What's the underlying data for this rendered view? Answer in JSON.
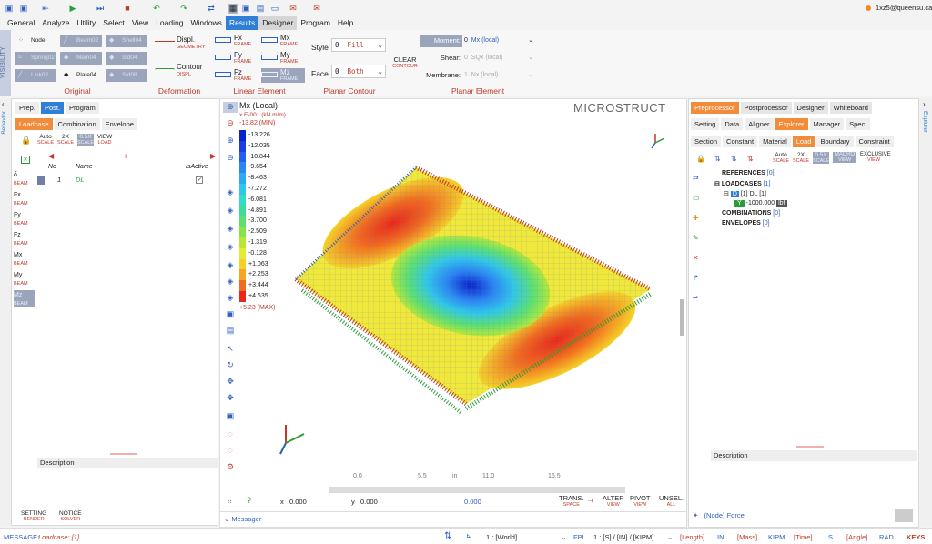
{
  "user": "1xz5@queensu.ca",
  "menu": [
    "General",
    "Analyze",
    "Utility",
    "Select",
    "View",
    "Loading",
    "Windows",
    "Results",
    "Designer",
    "Program",
    "Help"
  ],
  "ribbon": {
    "visibility": "VISIBILITY",
    "original": {
      "title": "Original",
      "items": [
        "Node",
        "Beam02",
        "Shell04",
        "Spring02",
        "Mem04",
        "Sld04",
        "Link02",
        "Plate04",
        "Sld08"
      ]
    },
    "deformation": {
      "title": "Deformation",
      "displ": "Displ.",
      "displ_sub": "GEOMETRY",
      "contour": "Contour",
      "contour_sub": "DISPL"
    },
    "linear": {
      "title": "Linear Element",
      "items": [
        {
          "l": "Fx",
          "s": "FRAME"
        },
        {
          "l": "Mx",
          "s": "FRAME"
        },
        {
          "l": "Fy",
          "s": "FRAME"
        },
        {
          "l": "My",
          "s": "FRAME"
        },
        {
          "l": "Fz",
          "s": "FRAME"
        },
        {
          "l": "Mz",
          "s": "FRAME"
        }
      ]
    },
    "planar": {
      "title": "Planar Contour",
      "style_label": "Style",
      "style_num": "0",
      "style_val": "Fill",
      "face_label": "Face",
      "face_num": "0",
      "face_val": "Both"
    },
    "clear": "CLEAR",
    "clear_sub": "CONTOUR",
    "planar_el": {
      "title": "Planar Element",
      "moment": "Moment:",
      "moment_num": "0",
      "moment_val": "Mx (local)",
      "shear": "Shear:",
      "shear_num": "0",
      "shear_val": "SQx (local)",
      "membrane": "Membrane:",
      "membrane_num": "1",
      "membrane_val": "Nx (local)"
    }
  },
  "left": {
    "behavior": "Behavior",
    "tabs": [
      "Prep.",
      "Post.",
      "Program"
    ],
    "subtabs": [
      "Loadcase",
      "Combination",
      "Envelope"
    ],
    "tools": [
      {
        "l": "Auto",
        "s": "SCALE"
      },
      {
        "l": "2X",
        "s": "SCALE"
      },
      {
        "l": "0.5X",
        "s": "SCALE"
      },
      {
        "l": "VIEW",
        "s": "LOAD"
      }
    ],
    "headers": [
      "No",
      "Name",
      "IsActive"
    ],
    "rows": [
      {
        "no": "1",
        "name": "DL"
      }
    ],
    "side": [
      {
        "l": "δ",
        "s": "BEAM"
      },
      {
        "l": "Fx",
        "s": "BEAM"
      },
      {
        "l": "Fy",
        "s": "BEAM"
      },
      {
        "l": "Fz",
        "s": "BEAM"
      },
      {
        "l": "Mx",
        "s": "BEAM"
      },
      {
        "l": "My",
        "s": "BEAM"
      },
      {
        "l": "Mz",
        "s": "BEAM"
      }
    ],
    "description": "Description",
    "setting": "SETTING",
    "setting_sub": "RENDER",
    "notice": "NOTICE",
    "notice_sub": "SOLVER"
  },
  "view": {
    "title": "Mx (Local)",
    "unit": "x E-001 (kN m/m)",
    "min": "-13.82 (MIN)",
    "max": "+5.23 (MAX)",
    "brand": "MICROSTRUCT",
    "legend": [
      "-13.226",
      "-12.035",
      "-10.844",
      "-9.654",
      "-8.463",
      "-7.272",
      "-6.081",
      "-4.891",
      "-3.700",
      "-2.509",
      "-1.319",
      "-0.128",
      "+1.063",
      "+2.253",
      "+3.444",
      "+4.635"
    ],
    "legend_colors": [
      "#0a22c8",
      "#1a3ee0",
      "#2460f0",
      "#2a86f4",
      "#2eaaf2",
      "#30c8e8",
      "#32dcc8",
      "#3edc98",
      "#5ee070",
      "#86e44a",
      "#b6e83a",
      "#e2ec32",
      "#f4d22a",
      "#f6a424",
      "#f26a1e",
      "#e8281a"
    ],
    "ruler": [
      "0.0",
      "5.5",
      "in",
      "11.0",
      "16.5"
    ],
    "x_label": "x",
    "x_val": "0.000",
    "y_label": "y",
    "y_val": "0.000",
    "z_val": "0.000",
    "tools": [
      {
        "l": "TRANS.",
        "s": "SPACE"
      },
      {
        "l": "ALTER",
        "s": "VIEW"
      },
      {
        "l": "PIVOT",
        "s": "VIEW"
      },
      {
        "l": "UNSEL.",
        "s": "ALL"
      }
    ],
    "messager": "Messager"
  },
  "right": {
    "explorer": "Explorer",
    "tabs": [
      "Preprocessor",
      "Postprocessor",
      "Designer",
      "Whiteboard"
    ],
    "tabs2": [
      "Setting",
      "Data",
      "Aligner",
      "Explorer",
      "Manager",
      "Spec."
    ],
    "tabs3": [
      "Section",
      "Constant",
      "Material",
      "Load",
      "Boundary",
      "Constraint"
    ],
    "tools": [
      {
        "l": "Auto",
        "s": "SCALE"
      },
      {
        "l": "2X",
        "s": "SCALE"
      },
      {
        "l": "0.5X",
        "s": "SCALE"
      },
      {
        "l": "MACRO",
        "s": "VIEW"
      },
      {
        "l": "EXCLUSIVE",
        "s": "VIEW"
      }
    ],
    "tree": {
      "references": "REFERENCES",
      "ref_count": "[0]",
      "loadcases": "LOADCASES",
      "lc_count": "[1]",
      "lc_item": "[1] DL [1]",
      "load_val": "-1000.000",
      "load_unit": "lbf",
      "combinations": "COMBINATIONS",
      "comb_count": "[0]",
      "envelopes": "ENVELOPES",
      "env_count": "[0]"
    },
    "description": "Description",
    "footer": "(Node) Force"
  },
  "status": {
    "message_label": "MESSAGE:",
    "message": "Loadcase: [1]",
    "world": "1 : [World]",
    "units": "1 : [S] / [IN] / [KIPM]",
    "length": "[Length]",
    "in": "IN",
    "mass": "[Mass]",
    "kipm": "KIPM",
    "time": "[Time]",
    "s": "S",
    "angle": "[Angle]",
    "rad": "RAD",
    "keys": "KEYS"
  }
}
